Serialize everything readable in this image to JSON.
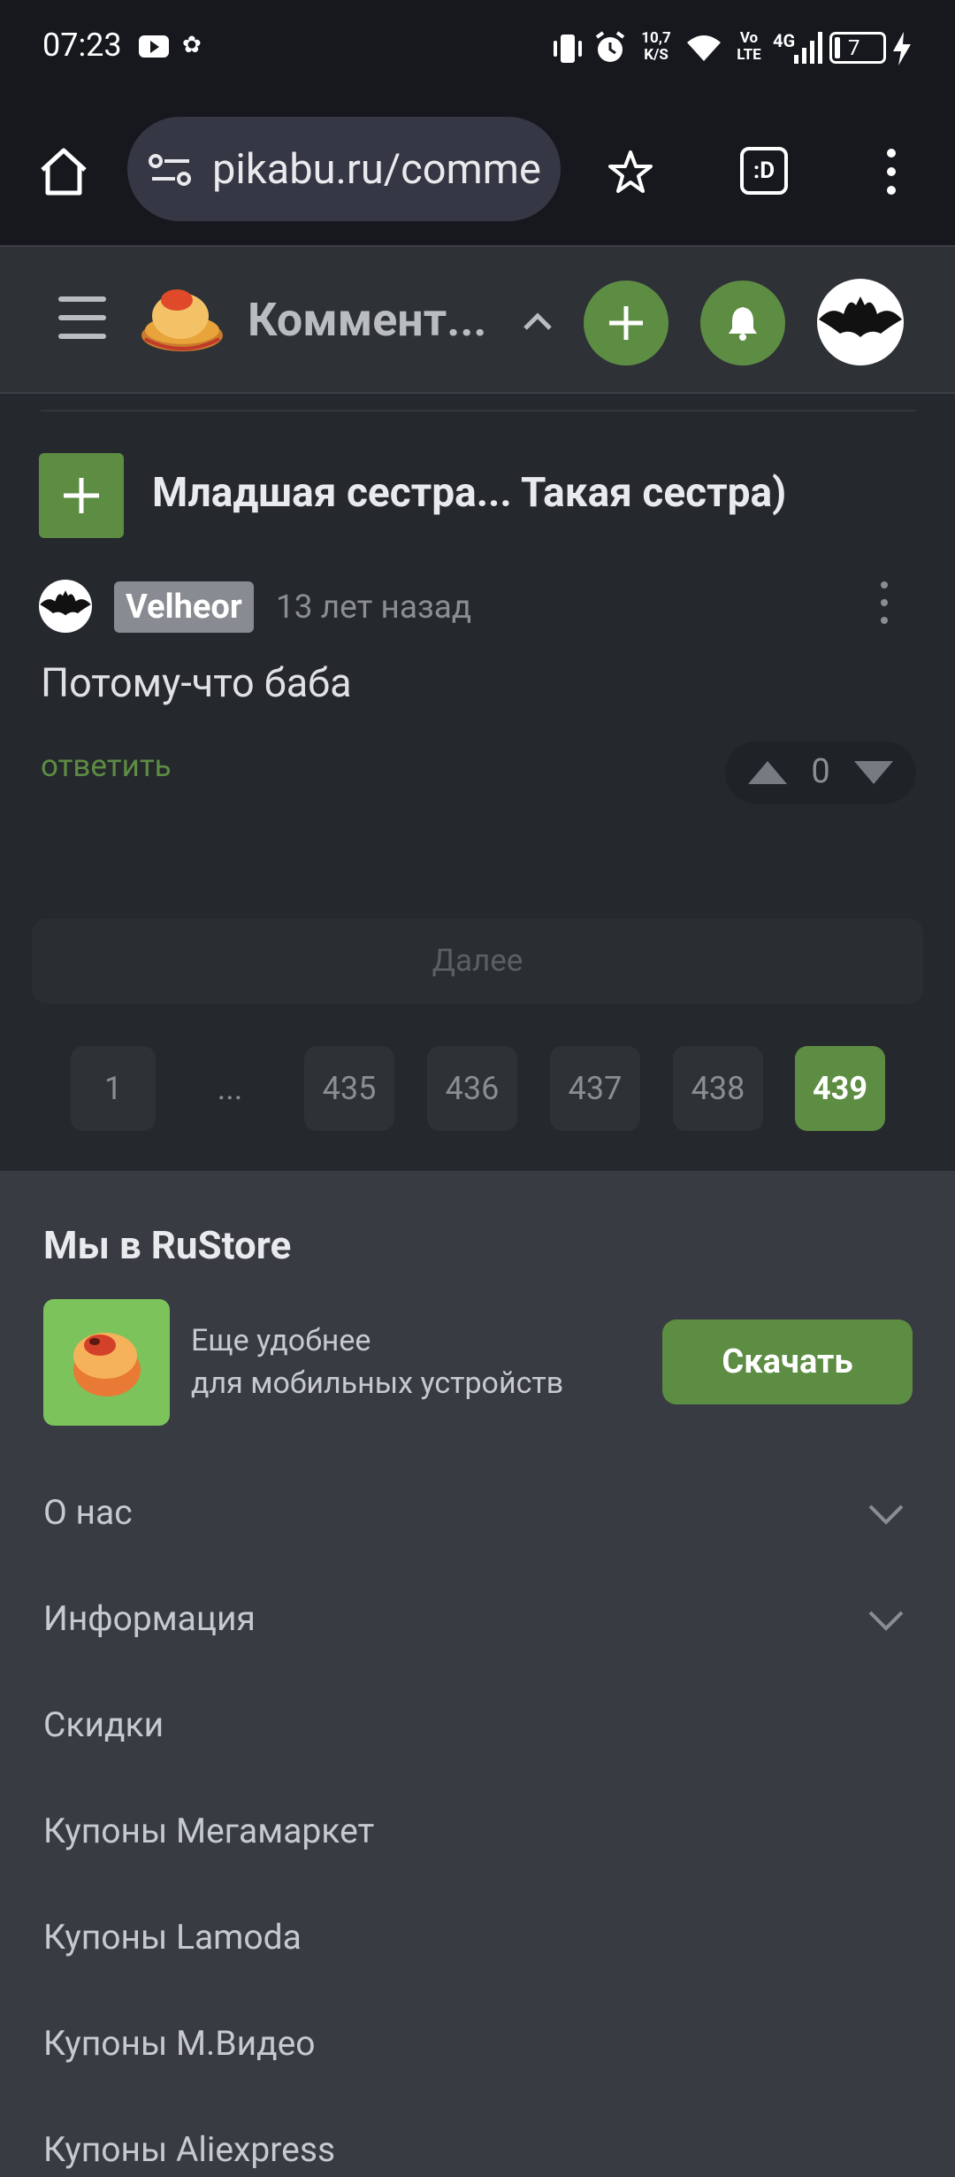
{
  "status_bar": {
    "time": "07:23",
    "net_speed_top": "10,7",
    "net_speed_bottom": "K/S",
    "volte_top": "Vo",
    "volte_bottom": "LTE",
    "network": "4G",
    "battery": "7"
  },
  "browser": {
    "url": "pikabu.ru/comme"
  },
  "site_header": {
    "title": "Коммент..."
  },
  "post": {
    "title": "Младшая сестра... Такая сестра)"
  },
  "comment": {
    "author": "Velheor",
    "time": "13 лет назад",
    "text": "Потому-что баба",
    "reply_label": "ответить",
    "score": "0"
  },
  "more_button": "Далее",
  "pagination": {
    "pages": [
      "1",
      "...",
      "435",
      "436",
      "437",
      "438",
      "439"
    ],
    "current": "439"
  },
  "footer": {
    "rustore_title": "Мы в RuStore",
    "app_line1": "Еще удобнее",
    "app_line2": "для мобильных устройств",
    "download_label": "Скачать",
    "links": [
      "О нас",
      "Информация",
      "Скидки",
      "Купоны Мегамаркет",
      "Купоны Lamoda",
      "Купоны М.Видео",
      "Купоны Aliexpress"
    ]
  },
  "colors": {
    "accent_green": "#5d8c43",
    "background": "#25282c",
    "footer_bg": "#383b41"
  }
}
